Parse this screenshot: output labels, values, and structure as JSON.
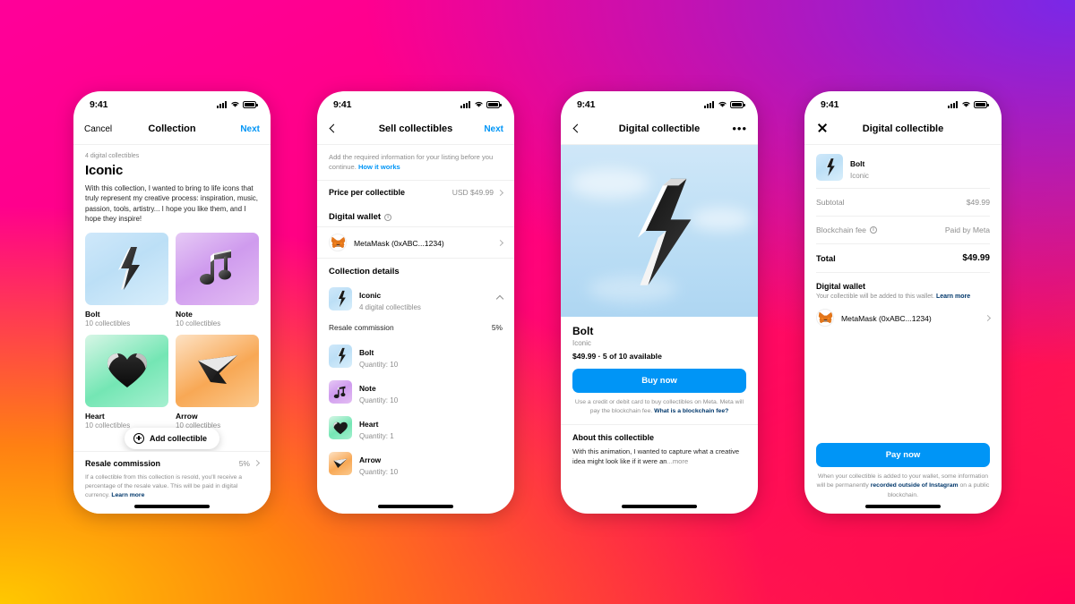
{
  "background": {
    "gradient_colors": [
      "#FF0099",
      "#7928E8",
      "#FFC800",
      "#FF0055"
    ]
  },
  "status_bar": {
    "time": "9:41",
    "signal_icon": "cellular-bars-icon",
    "wifi_icon": "wifi-icon",
    "battery_icon": "battery-icon"
  },
  "accent": {
    "blue": "#0095F6",
    "link_dark": "#00376B"
  },
  "phone1": {
    "nav": {
      "left_label": "Cancel",
      "title": "Collection",
      "right_label": "Next"
    },
    "eyebrow": "4 digital collectibles",
    "title": "Iconic",
    "description": "With this collection, I wanted to bring to life icons that truly represent my creative process: inspiration, music, passion, tools, artistry... I hope you like them, and I hope they inspire!",
    "cards": [
      {
        "name": "Bolt",
        "subtitle": "10 collectibles",
        "icon": "bolt-icon",
        "theme": "sky"
      },
      {
        "name": "Note",
        "subtitle": "10 collectibles",
        "icon": "music-note-icon",
        "theme": "violet"
      },
      {
        "name": "Heart",
        "subtitle": "10 collectibles",
        "icon": "heart-icon",
        "theme": "mint"
      },
      {
        "name": "Arrow",
        "subtitle": "10 collectibles",
        "icon": "arrow-icon",
        "theme": "orange"
      }
    ],
    "add_button": "Add collectible",
    "resale": {
      "label": "Resale commission",
      "value": "5%"
    },
    "fineprint": "If a collectible from this collection is resold, you'll receive a percentage of the resale value. This will be paid in digital currency. ",
    "fineprint_link": "Learn more"
  },
  "phone2": {
    "nav": {
      "title": "Sell collectibles",
      "right_label": "Next"
    },
    "intro": "Add the required information for your listing before you continue. ",
    "intro_link": "How it works",
    "price_row": {
      "label": "Price per collectible",
      "value": "USD $49.99"
    },
    "wallet_heading": "Digital wallet",
    "wallet": {
      "name": "MetaMask (0xABC...1234)",
      "icon": "metamask-fox-icon"
    },
    "collection_heading": "Collection details",
    "collection": {
      "name": "Iconic",
      "subtitle": "4 digital collectibles",
      "icon": "bolt-icon",
      "theme": "sky"
    },
    "resale": {
      "label": "Resale commission",
      "value": "5%"
    },
    "items": [
      {
        "name": "Bolt",
        "subtitle": "Quantity: 10",
        "icon": "bolt-icon",
        "theme": "sky"
      },
      {
        "name": "Note",
        "subtitle": "Quantity: 10",
        "icon": "music-note-icon",
        "theme": "violet"
      },
      {
        "name": "Heart",
        "subtitle": "Quantity: 1",
        "icon": "heart-icon",
        "theme": "mint"
      },
      {
        "name": "Arrow",
        "subtitle": "Quantity: 10",
        "icon": "arrow-icon",
        "theme": "orange"
      }
    ]
  },
  "phone3": {
    "nav": {
      "title": "Digital collectible",
      "more_icon": "more-options-icon"
    },
    "hero_icon": "bolt-3d-icon",
    "title": "Bolt",
    "collection": "Iconic",
    "price": "$49.99 · 5 of 10 available",
    "buy_button": "Buy now",
    "buy_note": "Use a credit or debit card to buy collectibles on Meta. Meta will pay the blockchain fee. ",
    "buy_note_link": "What is a blockchain fee?",
    "about_heading": "About this collectible",
    "about_text": "With this animation, I wanted to capture what a creative idea might look like if it were an",
    "about_more": "...more"
  },
  "phone4": {
    "nav": {
      "title": "Digital collectible",
      "close_icon": "close-icon"
    },
    "item": {
      "name": "Bolt",
      "collection": "Iconic",
      "icon": "bolt-icon",
      "theme": "sky"
    },
    "subtotal": {
      "label": "Subtotal",
      "value": "$49.99"
    },
    "blockchain_fee": {
      "label": "Blockchain fee",
      "value": "Paid by Meta",
      "info_icon": "info-icon"
    },
    "total": {
      "label": "Total",
      "value": "$49.99"
    },
    "wallet_heading": "Digital wallet",
    "wallet_desc": "Your collectible will be added to this wallet. ",
    "wallet_desc_link": "Learn more",
    "wallet": {
      "name": "MetaMask (0xABC...1234)",
      "icon": "metamask-fox-icon"
    },
    "pay_button": "Pay now",
    "pay_note_1": "When your collectible is added to your wallet, some information will be permanently ",
    "pay_note_link": "recorded outside of Instagram",
    "pay_note_2": " on a public blockchain."
  }
}
